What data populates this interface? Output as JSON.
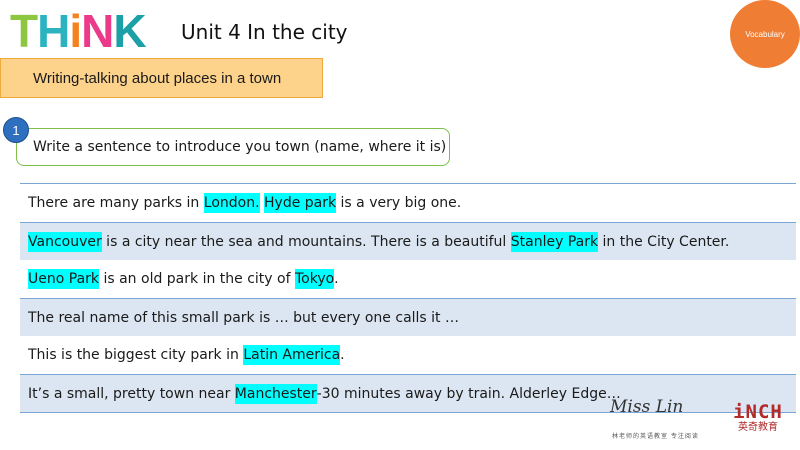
{
  "header": {
    "logo": [
      {
        "letter": "T",
        "color": "#8dc63f"
      },
      {
        "letter": "H",
        "color": "#2bb3c0"
      },
      {
        "letter": "i",
        "color": "#f58220"
      },
      {
        "letter": "N",
        "color": "#ec3a8b"
      },
      {
        "letter": "K",
        "color": "#1aa0a6"
      }
    ],
    "title": "Unit 4 In the city",
    "vocabulary_label": "Vocabulary"
  },
  "topic": "Writing-talking about places in a town",
  "task": {
    "number": "1",
    "text": "Write a sentence to introduce you town (name, where it is)"
  },
  "sentences": [
    [
      {
        "text": "There are many parks in "
      },
      {
        "text": "London.",
        "hl": true
      },
      {
        "text": " "
      },
      {
        "text": "Hyde park",
        "hl": true
      },
      {
        "text": " is a very big one."
      }
    ],
    [
      {
        "text": "Vancouver",
        "hl": true
      },
      {
        "text": " is a city near the sea and mountains. There is a beautiful "
      },
      {
        "text": "Stanley Park",
        "hl": true
      },
      {
        "text": " in the City Center."
      }
    ],
    [
      {
        "text": "Ueno Park",
        "hl": true
      },
      {
        "text": " is an old park in the city of "
      },
      {
        "text": "Tokyo",
        "hl": true
      },
      {
        "text": "."
      }
    ],
    [
      {
        "text": "The real name of this small park is … but every one calls it …"
      }
    ],
    [
      {
        "text": "This is the biggest city park in "
      },
      {
        "text": "Latin America",
        "hl": true
      },
      {
        "text": "."
      }
    ],
    [
      {
        "text": "It’s a small, pretty town near "
      },
      {
        "text": "Manchester",
        "hl": true
      },
      {
        "text": "-30 minutes away by train. Alderley Edge…"
      }
    ]
  ],
  "footer": {
    "signature": "Miss Lin",
    "tagline": "林老师的英语教室  专注阅读",
    "brand_top": "iNCH",
    "brand_bottom": "英奇教育"
  }
}
